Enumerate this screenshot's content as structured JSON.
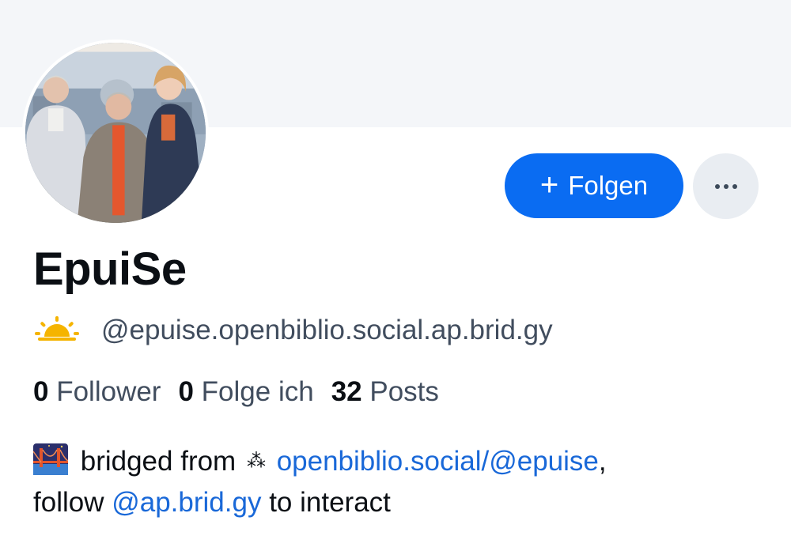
{
  "profile": {
    "avatar_alt": "Profile picture",
    "display_name": "EpuiSe",
    "handle_icon": "sunrise-emoji",
    "handle": "@epuise.openbiblio.social.ap.brid.gy",
    "follow_button": {
      "icon": "plus-icon",
      "plus": "+",
      "label": "Folgen"
    },
    "more_button": {
      "icon": "ellipsis-icon"
    }
  },
  "stats": {
    "followers": {
      "count": "0",
      "label": "Follower"
    },
    "following": {
      "count": "0",
      "label": "Folge ich"
    },
    "posts": {
      "count": "32",
      "label": "Posts"
    }
  },
  "bio": {
    "bridge_icon": "bridge-at-night-emoji",
    "text_1": "bridged from",
    "sparkle": "⁂",
    "link_1": "openbiblio.social/@epuise",
    "text_2": ",",
    "text_3": "follow",
    "link_2": "@ap.brid.gy",
    "text_4": "to interact"
  },
  "colors": {
    "accent": "#0a6cf2",
    "link": "#1968d8",
    "muted_text": "#414d5e",
    "banner": "#f4f6f9"
  }
}
